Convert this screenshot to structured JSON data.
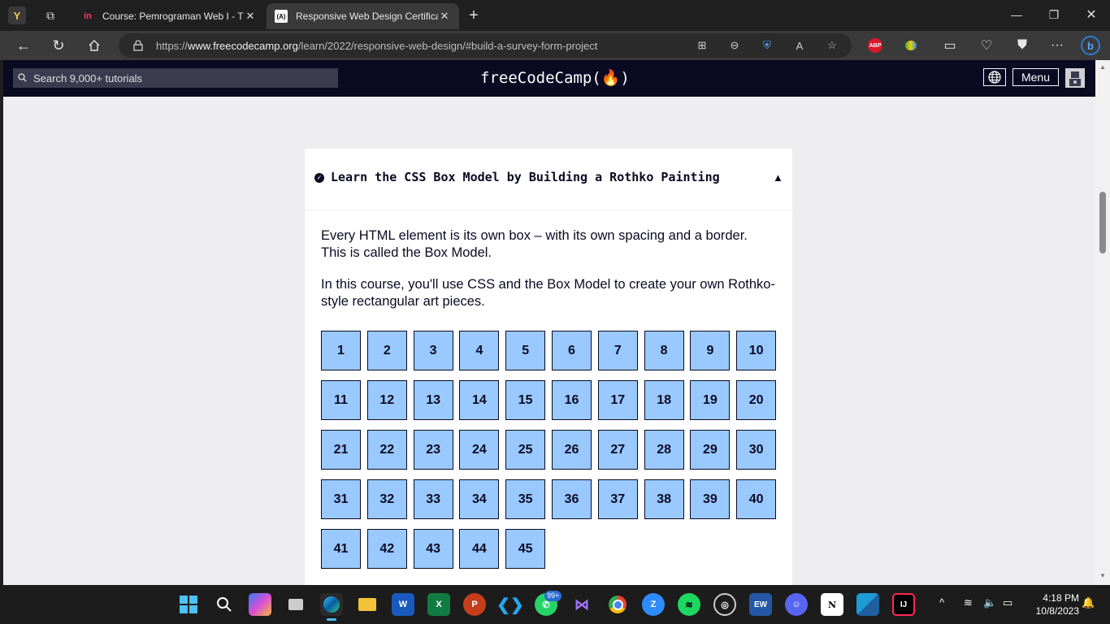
{
  "browser": {
    "tabs": [
      {
        "title": "Course: Pemrograman Web I - TI",
        "favicon": "in",
        "active": false
      },
      {
        "title": "Responsive Web Design Certificati",
        "favicon": "(A)",
        "active": true
      }
    ],
    "url_prefix": "https://",
    "url_domain": "www.freecodecamp.org",
    "url_path": "/learn/2022/responsive-web-design/#build-a-survey-form-project",
    "abp_label": "ABP"
  },
  "fcc": {
    "search_placeholder": "Search 9,000+ tutorials",
    "brand": "freeCodeCamp(🔥)",
    "menu_label": "Menu"
  },
  "course": {
    "title": "Learn the CSS Box Model by Building a Rothko Painting",
    "description_1": "Every HTML element is its own box – with its own spacing and a border. This is called the Box Model.",
    "description_2": "In this course, you'll use CSS and the Box Model to create your own Rothko-style rectangular art pieces.",
    "steps": [
      "1",
      "2",
      "3",
      "4",
      "5",
      "6",
      "7",
      "8",
      "9",
      "10",
      "11",
      "12",
      "13",
      "14",
      "15",
      "16",
      "17",
      "18",
      "19",
      "20",
      "21",
      "22",
      "23",
      "24",
      "25",
      "26",
      "27",
      "28",
      "29",
      "30",
      "31",
      "32",
      "33",
      "34",
      "35",
      "36",
      "37",
      "38",
      "39",
      "40",
      "41",
      "42",
      "43",
      "44",
      "45"
    ]
  },
  "taskbar": {
    "whatsapp_badge": "99+",
    "time": "4:18 PM",
    "date": "10/8/2023"
  },
  "colors": {
    "fcc_nav": "#0a0a23",
    "step_fill": "#99c9ff",
    "page_bg": "#eeeef0"
  }
}
